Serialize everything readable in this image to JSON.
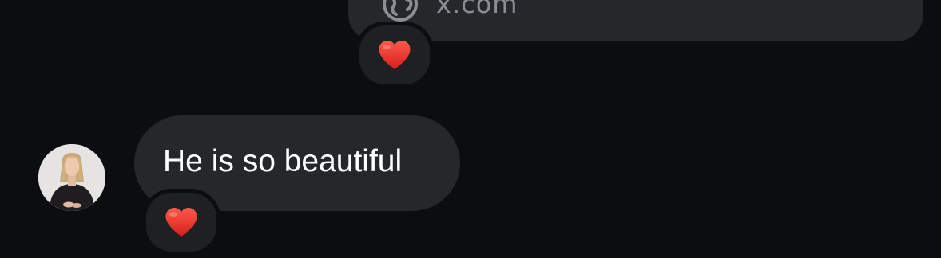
{
  "thread": {
    "link_message": {
      "domain": "x.com",
      "icon": "globe-icon",
      "reaction": "❤️"
    },
    "text_message": {
      "text": "He is so beautiful",
      "reaction": "❤️",
      "avatar": "contact-avatar"
    }
  },
  "colors": {
    "background": "#0b0d11",
    "bubble": "#25272b",
    "reaction_pill": "#1e2024",
    "heart": "#e5312a",
    "muted_text": "#8b8e94"
  }
}
